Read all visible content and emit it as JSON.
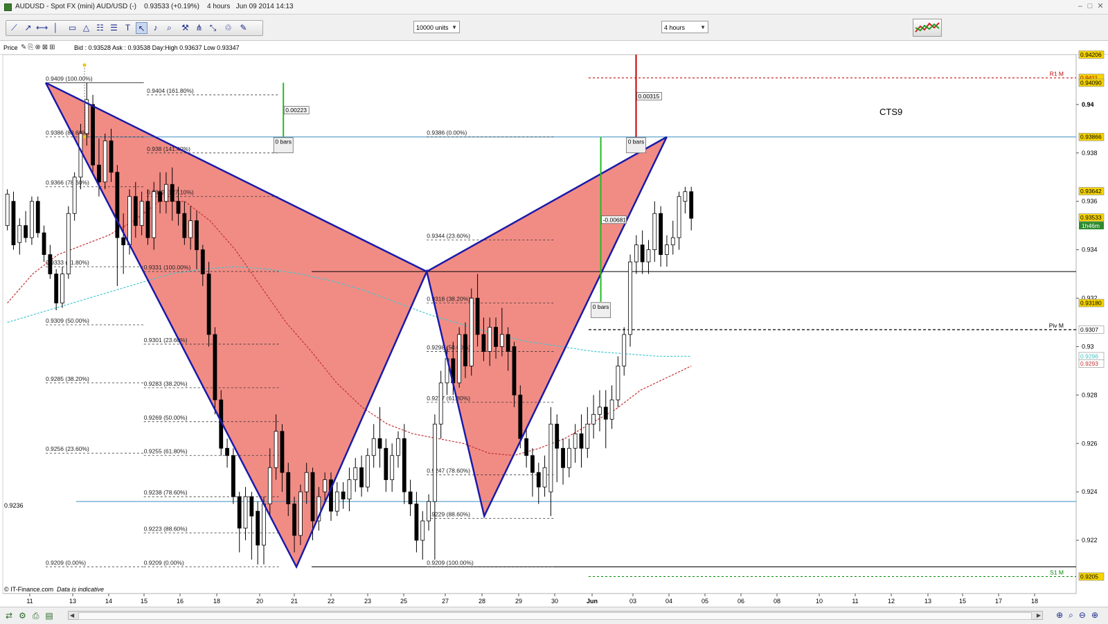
{
  "window": {
    "title": "AUDUSD - Spot FX (mini) AUD/USD (-)    0.93533 (+0.19%)    4 hours   Jun 09 2014 14:13",
    "controls": [
      "–",
      "□",
      "✕"
    ]
  },
  "toolbar": {
    "units_select": "10000 units",
    "timeframe_select": "4 hours"
  },
  "pricebar": {
    "label": "Price",
    "info": "Bid : 0.93528 Ask : 0.93538 Day:High 0.93637 Low 0.93347"
  },
  "footer": {
    "copyright": "© IT-Finance.com",
    "disclaimer": "Data is indicative"
  },
  "chart_data": {
    "type": "candlestick",
    "symbol": "AUDUSD",
    "timeframe": "4 hours",
    "x_tick_labels": [
      "11",
      "13",
      "14",
      "15",
      "16",
      "18",
      "20",
      "21",
      "22",
      "23",
      "25",
      "27",
      "28",
      "29",
      "30",
      "Jun",
      "03",
      "04",
      "05",
      "06",
      "08",
      "10",
      "11",
      "12",
      "13",
      "15",
      "17",
      "18"
    ],
    "ylim": [
      0.9202,
      0.9422
    ],
    "y_ticks": [
      {
        "label": "0.94",
        "value": 0.94
      },
      {
        "label": "0.938",
        "value": 0.938
      },
      {
        "label": "0.936",
        "value": 0.936
      },
      {
        "label": "0.934",
        "value": 0.934
      },
      {
        "label": "0.932",
        "value": 0.932
      },
      {
        "label": "0.93",
        "value": 0.93
      },
      {
        "label": "0.928",
        "value": 0.928
      },
      {
        "label": "0.926",
        "value": 0.926
      },
      {
        "label": "0.924",
        "value": 0.924
      },
      {
        "label": "0.922",
        "value": 0.922
      }
    ],
    "price_markers": [
      {
        "label": "0.94206",
        "value": 0.94206,
        "bg": "#f5d400",
        "fg": "#000000"
      },
      {
        "label": "0.9411",
        "value": 0.9411,
        "bg": "#f5d400",
        "fg": "#b00000"
      },
      {
        "label": "0.94090",
        "value": 0.9409,
        "bg": "#f5d400",
        "fg": "#000000"
      },
      {
        "label": "0.93866",
        "value": 0.93866,
        "bg": "#f5d400",
        "fg": "#000000"
      },
      {
        "label": "0.93642",
        "value": 0.93642,
        "bg": "#f5d400",
        "fg": "#000000"
      },
      {
        "label": "0.93533",
        "value": 0.93533,
        "bg": "#f5d400",
        "fg": "#000000"
      },
      {
        "label": "0.93180",
        "value": 0.9318,
        "bg": "#f5d400",
        "fg": "#000000"
      },
      {
        "label": "0.9307",
        "value": 0.9307,
        "bg": "#ffffff",
        "fg": "#000000"
      },
      {
        "label": "0.9296",
        "value": 0.9296,
        "bg": "#ffffff",
        "fg": "#40c0c0"
      },
      {
        "label": "0.9293",
        "value": 0.9293,
        "bg": "#ffffff",
        "fg": "#c03030"
      },
      {
        "label": "0.9205",
        "value": 0.9205,
        "bg": "#f5d400",
        "fg": "#000000"
      }
    ],
    "countdown": "1h46m",
    "pivot_labels": [
      {
        "label": "R1 M",
        "value": 0.9411,
        "color": "#c00000"
      },
      {
        "label": "Piv M",
        "value": 0.9307,
        "color": "#000000"
      },
      {
        "label": "S1 M",
        "value": 0.9205,
        "color": "#008800"
      }
    ],
    "horizontal_level_label": "0.9236",
    "horizontal_levels": [
      {
        "value": 0.93866,
        "color": "#3a8ec0"
      },
      {
        "value": 0.9236,
        "color": "#3a8ec0"
      },
      {
        "value": 0.9331,
        "color": "#000000"
      },
      {
        "value": 0.9209,
        "color": "#000000"
      }
    ],
    "pattern_name": "CTS9",
    "pattern": {
      "color": "#1a1aa8",
      "fill": "#f08078",
      "points": [
        {
          "t": 5.6,
          "v": 0.9409
        },
        {
          "t": 38.3,
          "v": 0.9209
        },
        {
          "t": 55.3,
          "v": 0.9331
        },
        {
          "t": 62.8,
          "v": 0.923
        },
        {
          "t": 86.6,
          "v": 0.93866
        }
      ]
    },
    "fib_levels": [
      {
        "label": "0.9409 (100.00%)",
        "value": 0.9409,
        "t0": 5.6,
        "t1": 18.4,
        "solid": true
      },
      {
        "label": "0.9386 (88.60%)",
        "value": 0.93866,
        "t0": 5.6,
        "t1": 18.4
      },
      {
        "label": "0.9366 (78.60%)",
        "value": 0.9366,
        "t0": 5.6,
        "t1": 18.4
      },
      {
        "label": "0.9333 (61.80%)",
        "value": 0.9333,
        "t0": 5.6,
        "t1": 18.4
      },
      {
        "label": "0.9309 (50.00%)",
        "value": 0.9309,
        "t0": 5.6,
        "t1": 18.4
      },
      {
        "label": "0.9285 (38.20%)",
        "value": 0.9285,
        "t0": 5.6,
        "t1": 18.4
      },
      {
        "label": "0.9256 (23.60%)",
        "value": 0.9256,
        "t0": 5.6,
        "t1": 18.4
      },
      {
        "label": "0.9209 (0.00%)",
        "value": 0.9209,
        "t0": 5.6,
        "t1": 18.4
      },
      {
        "label": "0.9404 (161.80%)",
        "value": 0.9404,
        "t0": 18.8,
        "t1": 36.0
      },
      {
        "label": "0.938 (141.40%)",
        "value": 0.938,
        "t0": 18.8,
        "t1": 36.0
      },
      {
        "label": "0.9362 (127.10%)",
        "value": 0.9362,
        "t0": 18.8,
        "t1": 36.0
      },
      {
        "label": "0.9331 (100.00%)",
        "value": 0.9331,
        "t0": 18.4,
        "t1": 36.0
      },
      {
        "label": "0.9301 (23.60%)",
        "value": 0.9301,
        "t0": 18.4,
        "t1": 36.0
      },
      {
        "label": "0.9283 (38.20%)",
        "value": 0.9283,
        "t0": 18.4,
        "t1": 36.0
      },
      {
        "label": "0.9269 (50.00%)",
        "value": 0.9269,
        "t0": 18.4,
        "t1": 36.0
      },
      {
        "label": "0.9255 (61.80%)",
        "value": 0.9255,
        "t0": 18.4,
        "t1": 36.0
      },
      {
        "label": "0.9238 (78.60%)",
        "value": 0.9238,
        "t0": 18.4,
        "t1": 36.0
      },
      {
        "label": "0.9223 (88.60%)",
        "value": 0.9223,
        "t0": 18.4,
        "t1": 36.0
      },
      {
        "label": "0.9209 (0.00%)",
        "value": 0.9209,
        "t0": 18.4,
        "t1": 36.0
      },
      {
        "label": "0.9386 (0.00%)",
        "value": 0.93866,
        "t0": 55.3,
        "t1": 72.0
      },
      {
        "label": "0.9344 (23.60%)",
        "value": 0.9344,
        "t0": 55.3,
        "t1": 72.0
      },
      {
        "label": "0.9318 (38.20%)",
        "value": 0.9318,
        "t0": 55.3,
        "t1": 72.0
      },
      {
        "label": "0.9298 (50.00%)",
        "value": 0.9298,
        "t0": 55.3,
        "t1": 72.0
      },
      {
        "label": "0.9277 (61.80%)",
        "value": 0.9277,
        "t0": 55.3,
        "t1": 72.0
      },
      {
        "label": "0.9247 (78.60%)",
        "value": 0.9247,
        "t0": 55.3,
        "t1": 72.0
      },
      {
        "label": "0.9229 (88.60%)",
        "value": 0.9229,
        "t0": 55.3,
        "t1": 72.0
      },
      {
        "label": "0.9209 (100.00%)",
        "value": 0.9209,
        "t0": 55.3,
        "t1": 72.0
      }
    ],
    "measure_boxes": [
      {
        "value_label": "0.00223",
        "bars_label": "0 bars",
        "t": 36.6,
        "from": 0.93866,
        "to": 0.9409,
        "color": "#22bb22"
      },
      {
        "value_label": "-0.00681",
        "bars_label": "0 bars",
        "t": 78.0,
        "from": 0.93866,
        "to": 0.93185,
        "color": "#22bb22"
      },
      {
        "value_label": "0.00315",
        "bars_label": "0 bars",
        "t": 82.6,
        "from": 0.93866,
        "to": 0.94206,
        "color": "#c00000"
      }
    ],
    "candles": [
      [
        0.935,
        0.9363,
        0.9348,
        0.9365
      ],
      [
        0.936,
        0.9342,
        0.934,
        0.9364
      ],
      [
        0.9343,
        0.935,
        0.9338,
        0.9353
      ],
      [
        0.935,
        0.9345,
        0.9343,
        0.9356
      ],
      [
        0.9345,
        0.936,
        0.9342,
        0.9362
      ],
      [
        0.936,
        0.9347,
        0.9345,
        0.9362
      ],
      [
        0.9347,
        0.9338,
        0.9335,
        0.935
      ],
      [
        0.9338,
        0.933,
        0.9328,
        0.9342
      ],
      [
        0.933,
        0.9318,
        0.9315,
        0.9332
      ],
      [
        0.9318,
        0.933,
        0.9316,
        0.9333
      ],
      [
        0.933,
        0.9355,
        0.9328,
        0.9358
      ],
      [
        0.9355,
        0.937,
        0.9352,
        0.9372
      ],
      [
        0.937,
        0.9388,
        0.9365,
        0.9392
      ],
      [
        0.9388,
        0.9402,
        0.9383,
        0.9409
      ],
      [
        0.94,
        0.9375,
        0.9372,
        0.9404
      ],
      [
        0.9375,
        0.9368,
        0.9362,
        0.9386
      ],
      [
        0.9368,
        0.9385,
        0.9365,
        0.9388
      ],
      [
        0.9385,
        0.9372,
        0.9368,
        0.939
      ],
      [
        0.9372,
        0.9345,
        0.9325,
        0.9375
      ],
      [
        0.9345,
        0.9342,
        0.933,
        0.9355
      ],
      [
        0.9342,
        0.9362,
        0.9338,
        0.9365
      ],
      [
        0.9362,
        0.935,
        0.9345,
        0.9368
      ],
      [
        0.935,
        0.936,
        0.9346,
        0.9364
      ],
      [
        0.936,
        0.9345,
        0.9342,
        0.9365
      ],
      [
        0.9345,
        0.9364,
        0.934,
        0.9368
      ],
      [
        0.9364,
        0.936,
        0.9355,
        0.9372
      ],
      [
        0.936,
        0.9367,
        0.9355,
        0.9372
      ],
      [
        0.9367,
        0.936,
        0.9352,
        0.9374
      ],
      [
        0.936,
        0.9355,
        0.935,
        0.9366
      ],
      [
        0.9355,
        0.9345,
        0.9342,
        0.936
      ],
      [
        0.9345,
        0.9352,
        0.934,
        0.9358
      ],
      [
        0.9352,
        0.934,
        0.9332,
        0.9356
      ],
      [
        0.934,
        0.933,
        0.9325,
        0.9342
      ],
      [
        0.933,
        0.9305,
        0.93,
        0.9335
      ],
      [
        0.9305,
        0.9278,
        0.9272,
        0.9308
      ],
      [
        0.9278,
        0.9258,
        0.9255,
        0.9282
      ],
      [
        0.9258,
        0.9255,
        0.925,
        0.9262
      ],
      [
        0.9255,
        0.9238,
        0.9235,
        0.9258
      ],
      [
        0.9238,
        0.9225,
        0.9215,
        0.924
      ],
      [
        0.9225,
        0.9238,
        0.922,
        0.9242
      ],
      [
        0.9238,
        0.923,
        0.9212,
        0.924
      ],
      [
        0.9232,
        0.9218,
        0.921,
        0.9236
      ],
      [
        0.9218,
        0.9235,
        0.921,
        0.9238
      ],
      [
        0.9235,
        0.925,
        0.923,
        0.9258
      ],
      [
        0.925,
        0.9265,
        0.9245,
        0.9272
      ],
      [
        0.9265,
        0.9248,
        0.924,
        0.9268
      ],
      [
        0.9248,
        0.9235,
        0.923,
        0.9252
      ],
      [
        0.9235,
        0.9222,
        0.9215,
        0.9238
      ],
      [
        0.9222,
        0.924,
        0.9218,
        0.9243
      ],
      [
        0.924,
        0.9248,
        0.9235,
        0.9252
      ],
      [
        0.9248,
        0.9228,
        0.922,
        0.925
      ],
      [
        0.9228,
        0.9238,
        0.9224,
        0.9242
      ],
      [
        0.924,
        0.9245,
        0.9236,
        0.9248
      ],
      [
        0.9245,
        0.9232,
        0.9228,
        0.9248
      ],
      [
        0.9232,
        0.924,
        0.923,
        0.9244
      ],
      [
        0.924,
        0.9237,
        0.9233,
        0.9244
      ],
      [
        0.9237,
        0.9245,
        0.9232,
        0.925
      ],
      [
        0.9245,
        0.925,
        0.924,
        0.9254
      ],
      [
        0.925,
        0.9242,
        0.9238,
        0.9255
      ],
      [
        0.9242,
        0.9255,
        0.924,
        0.9258
      ],
      [
        0.9255,
        0.9262,
        0.925,
        0.9268
      ],
      [
        0.9262,
        0.9258,
        0.925,
        0.9275
      ],
      [
        0.9258,
        0.9245,
        0.924,
        0.9262
      ],
      [
        0.9245,
        0.9255,
        0.924,
        0.926
      ],
      [
        0.9255,
        0.9262,
        0.925,
        0.9265
      ],
      [
        0.9262,
        0.924,
        0.9235,
        0.9268
      ],
      [
        0.924,
        0.9235,
        0.923,
        0.9245
      ],
      [
        0.9235,
        0.922,
        0.9215,
        0.924
      ],
      [
        0.922,
        0.9228,
        0.9212,
        0.9232
      ],
      [
        0.9228,
        0.9236,
        0.9224,
        0.9239
      ],
      [
        0.9236,
        0.9268,
        0.9212,
        0.9272
      ],
      [
        0.9268,
        0.9285,
        0.9262,
        0.929
      ],
      [
        0.9285,
        0.9295,
        0.928,
        0.93
      ],
      [
        0.9295,
        0.9285,
        0.928,
        0.9302
      ],
      [
        0.9285,
        0.9305,
        0.9283,
        0.9308
      ],
      [
        0.9305,
        0.9292,
        0.9287,
        0.931
      ],
      [
        0.9292,
        0.932,
        0.9288,
        0.9324
      ],
      [
        0.932,
        0.9305,
        0.93,
        0.933
      ],
      [
        0.9305,
        0.9298,
        0.9294,
        0.9312
      ],
      [
        0.9298,
        0.9308,
        0.9292,
        0.9312
      ],
      [
        0.9308,
        0.93,
        0.9295,
        0.9312
      ],
      [
        0.93,
        0.9305,
        0.9296,
        0.9316
      ],
      [
        0.9305,
        0.9298,
        0.929,
        0.9308
      ],
      [
        0.93,
        0.928,
        0.9275,
        0.9302
      ],
      [
        0.928,
        0.9262,
        0.9258,
        0.9284
      ],
      [
        0.9262,
        0.9255,
        0.925,
        0.9266
      ],
      [
        0.9255,
        0.9248,
        0.9238,
        0.9258
      ],
      [
        0.9248,
        0.9242,
        0.9235,
        0.9252
      ],
      [
        0.9242,
        0.925,
        0.9238,
        0.9255
      ],
      [
        0.924,
        0.9268,
        0.923,
        0.9275
      ],
      [
        0.9268,
        0.9258,
        0.9244,
        0.9272
      ],
      [
        0.9258,
        0.925,
        0.9243,
        0.9262
      ],
      [
        0.925,
        0.9258,
        0.9246,
        0.9262
      ],
      [
        0.9258,
        0.9264,
        0.9252,
        0.9268
      ],
      [
        0.9264,
        0.9258,
        0.925,
        0.9272
      ],
      [
        0.9258,
        0.9268,
        0.9254,
        0.9275
      ],
      [
        0.9268,
        0.9272,
        0.9262,
        0.928
      ],
      [
        0.9272,
        0.9275,
        0.9265,
        0.9282
      ],
      [
        0.9275,
        0.927,
        0.9258,
        0.9282
      ],
      [
        0.927,
        0.9278,
        0.9266,
        0.9284
      ],
      [
        0.9278,
        0.9292,
        0.9275,
        0.9296
      ],
      [
        0.9292,
        0.9305,
        0.9288,
        0.9308
      ],
      [
        0.9305,
        0.9335,
        0.93,
        0.9338
      ],
      [
        0.9335,
        0.9342,
        0.933,
        0.9346
      ],
      [
        0.9342,
        0.9335,
        0.933,
        0.9348
      ],
      [
        0.9335,
        0.934,
        0.933,
        0.9344
      ],
      [
        0.934,
        0.9355,
        0.9335,
        0.936
      ],
      [
        0.9355,
        0.9338,
        0.9333,
        0.9358
      ],
      [
        0.9338,
        0.9342,
        0.9333,
        0.9346
      ],
      [
        0.9342,
        0.9345,
        0.9338,
        0.9352
      ],
      [
        0.9345,
        0.9362,
        0.934,
        0.9364
      ],
      [
        0.936,
        0.9364,
        0.9355,
        0.9366
      ],
      [
        0.9364,
        0.9353,
        0.9348,
        0.9366
      ]
    ],
    "ma_red": [
      0.9318,
      0.933,
      0.9338,
      0.9342,
      0.9346,
      0.9352,
      0.936,
      0.936,
      0.9352,
      0.934,
      0.9325,
      0.931,
      0.9298,
      0.9285,
      0.9275,
      0.9268,
      0.9264,
      0.9262,
      0.926,
      0.9256,
      0.9255,
      0.9258,
      0.9262,
      0.9268,
      0.9274,
      0.9282,
      0.9287,
      0.9292
    ],
    "ma_cyan": [
      0.931,
      0.9314,
      0.9318,
      0.9322,
      0.9326,
      0.933,
      0.9332,
      0.9333,
      0.9332,
      0.933,
      0.9327,
      0.9323,
      0.9318,
      0.9313,
      0.9309,
      0.9305,
      0.9302,
      0.93,
      0.9298,
      0.9297,
      0.9296,
      0.9296
    ]
  }
}
